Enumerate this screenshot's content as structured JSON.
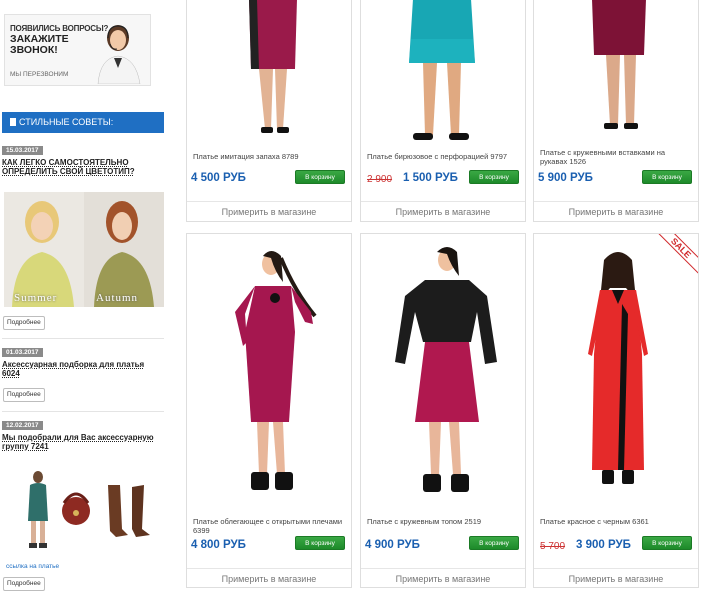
{
  "callback": {
    "question": "ПОЯВИЛИСЬ ВОПРОСЫ?",
    "title": "ЗАКАЖИТЕ ЗВОНОК!",
    "subtitle": "МЫ ПЕРЕЗВОНИМ"
  },
  "tips": {
    "header": "СТИЛЬНЫЕ СОВЕТЫ:",
    "items": [
      {
        "date": "15.03.2017",
        "title": "КАК ЛЕГКО САМОСТОЯТЕЛЬНО ОПРЕДЕЛИТЬ СВОЙ ЦВЕТОТИП?",
        "more": "Подробнее",
        "image_labels": [
          "Summer",
          "Autumn"
        ]
      },
      {
        "date": "01.03.2017",
        "title": "Аксессуарная подборка для платья 6024",
        "more": "Подробнее"
      },
      {
        "date": "12.02.2017",
        "title": "Мы подобрали для Вас аксессуарную группу 7241",
        "more": "Подробнее",
        "link": "ссылка на платье"
      }
    ]
  },
  "products": [
    {
      "name": "Платье имитация запаха 8789",
      "old_price": "",
      "price": "4 500 РУБ",
      "cart": "В корзину",
      "try": "Примерить в магазине",
      "color": "#9a1a4a",
      "sale": ""
    },
    {
      "name": "Платье бирюзовое с перфорацией 9797",
      "old_price": "2 900",
      "price": "1 500 РУБ",
      "cart": "В корзину",
      "try": "Примерить в магазине",
      "color": "#18a7b4",
      "sale": ""
    },
    {
      "name": "Платье с кружевными вставками на рукавах 1526",
      "old_price": "",
      "price": "5 900 РУБ",
      "cart": "В корзину",
      "try": "Примерить в магазине",
      "color": "#7d1236",
      "sale": ""
    },
    {
      "name": "Платье облегающее с открытыми плечами 6399",
      "old_price": "",
      "price": "4 800 РУБ",
      "cart": "В корзину",
      "try": "Примерить в магазине",
      "color": "#a5174f",
      "sale": ""
    },
    {
      "name": "Платье с кружевным топом 2519",
      "old_price": "",
      "price": "4 900 РУБ",
      "cart": "В корзину",
      "try": "Примерить в магазине",
      "color": "#b0184f",
      "sale": ""
    },
    {
      "name": "Платье красное с черным 6361",
      "old_price": "5 700",
      "price": "3 900 РУБ",
      "cart": "В корзину",
      "try": "Примерить в магазине",
      "color": "#e52a2a",
      "sale": "SALE"
    }
  ]
}
